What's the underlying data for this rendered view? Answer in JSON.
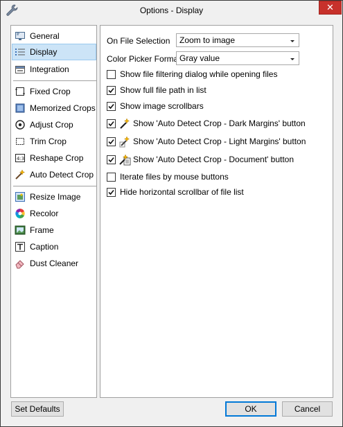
{
  "window": {
    "title": "Options - Display",
    "close_glyph": "✕"
  },
  "sidebar": {
    "items": [
      {
        "label": "General",
        "icon": "monitor-icon",
        "selected": false
      },
      {
        "label": "Display",
        "icon": "list-icon",
        "selected": true
      },
      {
        "label": "Integration",
        "icon": "integration-icon",
        "selected": false
      },
      {
        "label": "Fixed Crop",
        "icon": "fixed-crop-icon",
        "selected": false
      },
      {
        "label": "Memorized Crops",
        "icon": "memorized-crops-icon",
        "selected": false
      },
      {
        "label": "Adjust Crop",
        "icon": "adjust-crop-icon",
        "selected": false
      },
      {
        "label": "Trim Crop",
        "icon": "trim-crop-icon",
        "selected": false
      },
      {
        "label": "Reshape Crop",
        "icon": "reshape-crop-icon",
        "selected": false
      },
      {
        "label": "Auto Detect Crop",
        "icon": "magic-wand-icon",
        "selected": false
      },
      {
        "label": "Resize Image",
        "icon": "resize-image-icon",
        "selected": false
      },
      {
        "label": "Recolor",
        "icon": "color-wheel-icon",
        "selected": false
      },
      {
        "label": "Frame",
        "icon": "frame-icon",
        "selected": false
      },
      {
        "label": "Caption",
        "icon": "caption-icon",
        "selected": false
      },
      {
        "label": "Dust Cleaner",
        "icon": "eraser-icon",
        "selected": false
      }
    ]
  },
  "display": {
    "on_file_selection": {
      "label": "On File Selection",
      "value": "Zoom to image"
    },
    "color_picker_format": {
      "label": "Color Picker Format",
      "value": "Gray value"
    },
    "options": [
      {
        "label": "Show file filtering dialog while opening files",
        "checked": false,
        "icon": null
      },
      {
        "label": "Show full file path in list",
        "checked": true,
        "icon": null
      },
      {
        "label": "Show image scrollbars",
        "checked": true,
        "icon": null
      },
      {
        "label": "Show 'Auto Detect Crop - Dark Margins' button",
        "checked": true,
        "icon": "magic-wand-dark-icon"
      },
      {
        "label": "Show 'Auto Detect Crop - Light Margins' button",
        "checked": true,
        "icon": "magic-wand-light-icon"
      },
      {
        "label": "Show 'Auto Detect Crop - Document' button",
        "checked": true,
        "icon": "magic-wand-document-icon"
      },
      {
        "label": "Iterate files by mouse buttons",
        "checked": false,
        "icon": null
      },
      {
        "label": "Hide horizontal scrollbar of file list",
        "checked": true,
        "icon": null
      }
    ]
  },
  "buttons": {
    "set_defaults": "Set Defaults",
    "ok": "OK",
    "cancel": "Cancel"
  },
  "colors": {
    "accent": "#0078d7",
    "close": "#c7312b",
    "selection": "#cce4f7"
  }
}
